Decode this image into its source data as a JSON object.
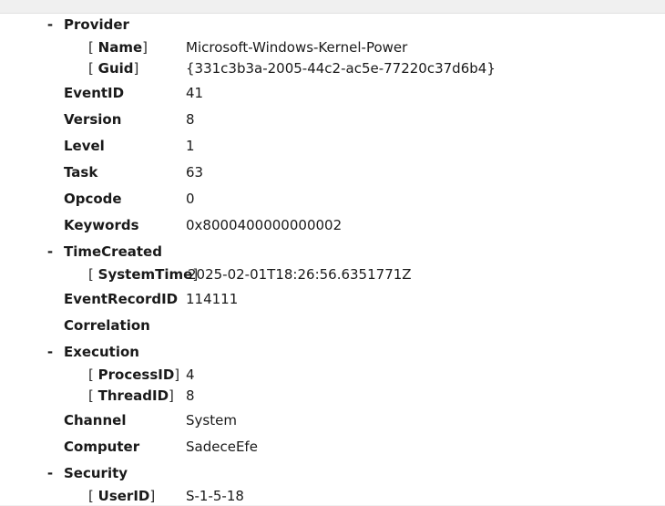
{
  "provider": {
    "label": "Provider",
    "toggle": "-",
    "name_key": "Name",
    "name_value": "Microsoft-Windows-Kernel-Power",
    "guid_key": "Guid",
    "guid_value": "{331c3b3a-2005-44c2-ac5e-77220c37d6b4}"
  },
  "fields": {
    "eventid": {
      "key": "EventID",
      "value": "41"
    },
    "version": {
      "key": "Version",
      "value": "8"
    },
    "level": {
      "key": "Level",
      "value": "1"
    },
    "task": {
      "key": "Task",
      "value": "63"
    },
    "opcode": {
      "key": "Opcode",
      "value": "0"
    },
    "keywords": {
      "key": "Keywords",
      "value": "0x8000400000000002"
    }
  },
  "timecreated": {
    "label": "TimeCreated",
    "toggle": "-",
    "attr_key": "SystemTime",
    "attr_value": "2025-02-01T18:26:56.6351771Z"
  },
  "eventrecordid": {
    "key": "EventRecordID",
    "value": "114111"
  },
  "correlation": {
    "key": "Correlation"
  },
  "execution": {
    "label": "Execution",
    "toggle": "-",
    "process_key": "ProcessID",
    "process_value": "4",
    "thread_key": "ThreadID",
    "thread_value": "8"
  },
  "channel": {
    "key": "Channel",
    "value": "System"
  },
  "computer": {
    "key": "Computer",
    "value": "SadeceEfe"
  },
  "security": {
    "label": "Security",
    "toggle": "-",
    "userid_key": "UserID",
    "userid_value": "S-1-5-18"
  },
  "brackets": {
    "open": "[",
    "close": "]"
  }
}
